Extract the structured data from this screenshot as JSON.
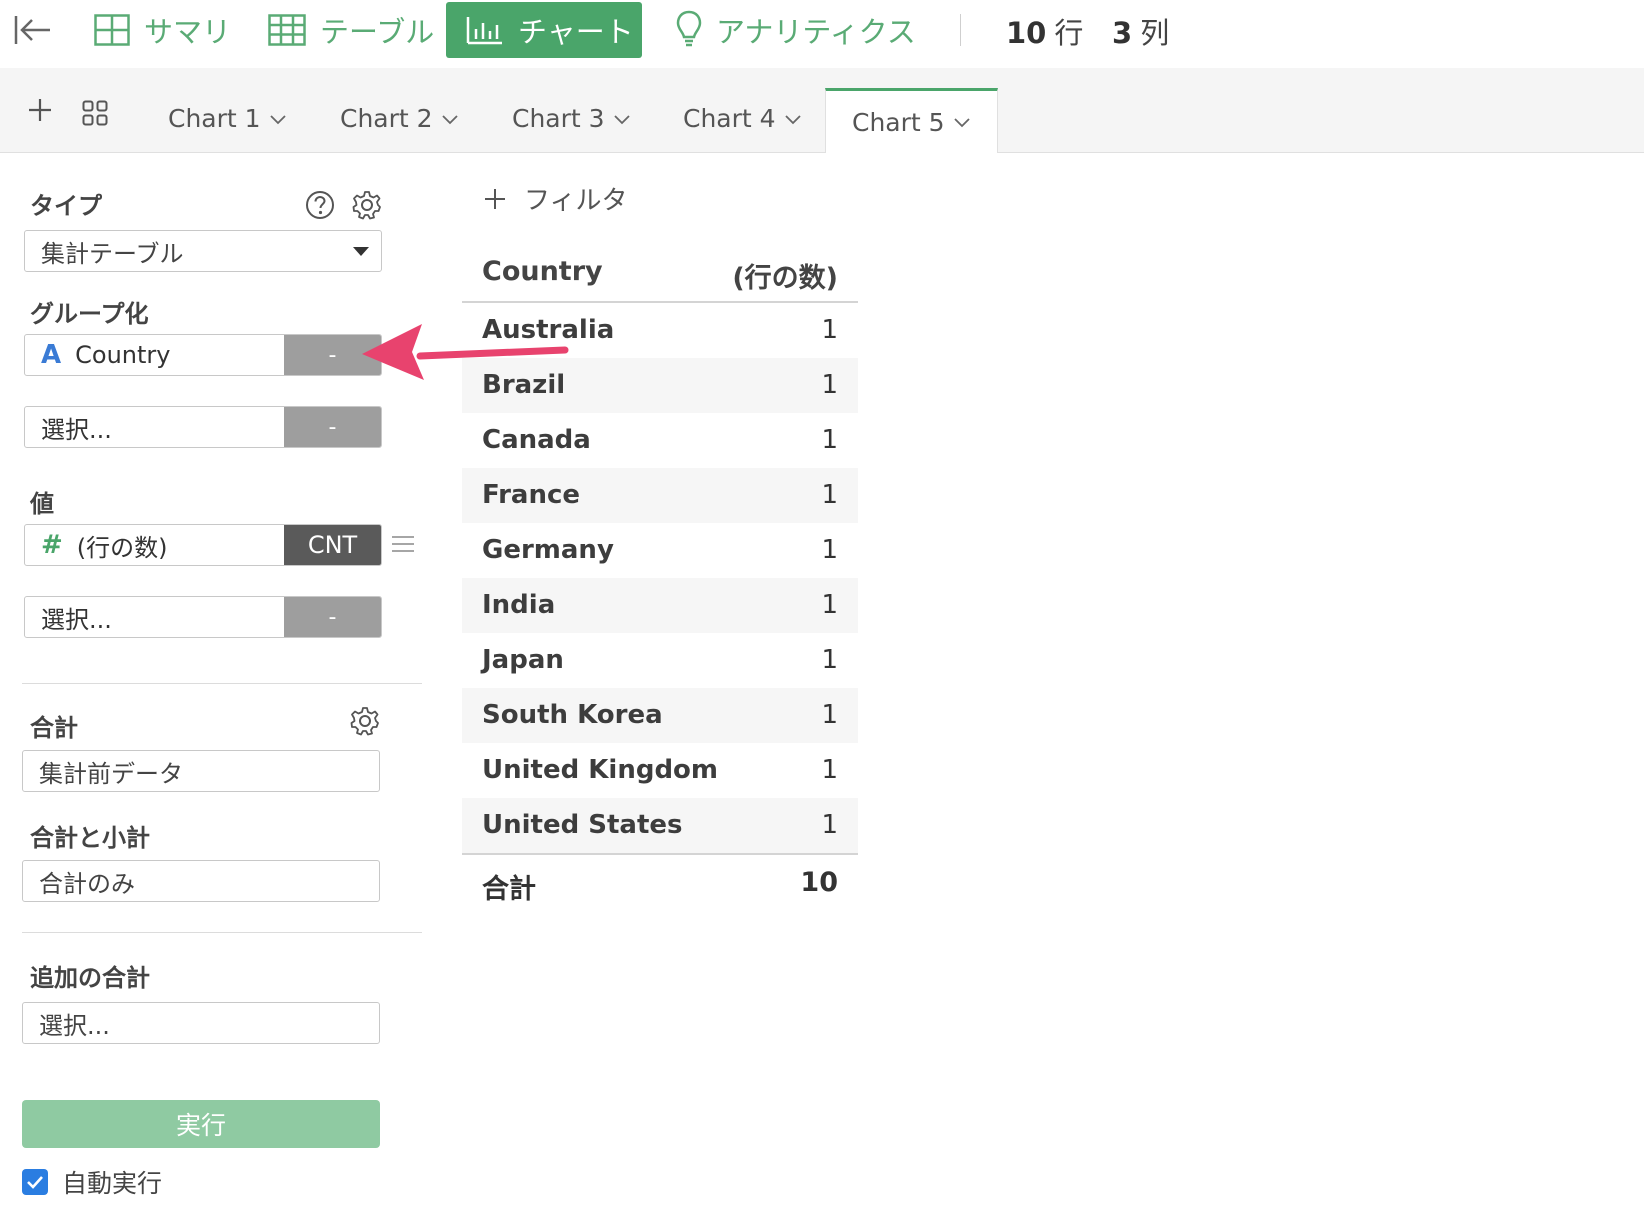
{
  "toolbar": {
    "summary": "サマリ",
    "table": "テーブル",
    "chart": "チャート",
    "analytics": "アナリティクス",
    "rows_value": "10",
    "rows_unit": "行",
    "cols_value": "3",
    "cols_unit": "列"
  },
  "tabs": [
    {
      "label": "Chart 1"
    },
    {
      "label": "Chart 2"
    },
    {
      "label": "Chart 3"
    },
    {
      "label": "Chart 4"
    },
    {
      "label": "Chart 5"
    }
  ],
  "active_tab": "Chart 5",
  "panel": {
    "type_label": "タイプ",
    "type_value": "集計テーブル",
    "group_label": "グループ化",
    "group_field": "Country",
    "group_field_icon": "A",
    "group_field_btn": "-",
    "group_select": "選択...",
    "group_select_btn": "-",
    "value_label": "値",
    "value_field": "(行の数)",
    "value_field_icon": "#",
    "value_field_btn": "CNT",
    "value_select": "選択...",
    "value_select_btn": "-",
    "total_label": "合計",
    "total_value": "集計前データ",
    "subtotal_label": "合計と小計",
    "subtotal_value": "合計のみ",
    "extra_total_label": "追加の合計",
    "extra_total_value": "選択...",
    "run_label": "実行",
    "auto_run_label": "自動実行",
    "auto_run_checked": true
  },
  "filter_label": "フィルタ",
  "table": {
    "headers": [
      "Country",
      "(行の数)"
    ],
    "rows": [
      {
        "country": "Australia",
        "count": "1"
      },
      {
        "country": "Brazil",
        "count": "1"
      },
      {
        "country": "Canada",
        "count": "1"
      },
      {
        "country": "France",
        "count": "1"
      },
      {
        "country": "Germany",
        "count": "1"
      },
      {
        "country": "India",
        "count": "1"
      },
      {
        "country": "Japan",
        "count": "1"
      },
      {
        "country": "South Korea",
        "count": "1"
      },
      {
        "country": "United Kingdom",
        "count": "1"
      },
      {
        "country": "United States",
        "count": "1"
      }
    ],
    "total_label": "合計",
    "total_value": "10"
  },
  "colors": {
    "accent": "#4aa56a",
    "accent_light": "#8fcaa2",
    "annotation_arrow": "#e8436e",
    "checkbox": "#2a7de1",
    "text_field_icon": "#3a7bd5",
    "number_field_icon": "#4aa56a"
  },
  "icons": {
    "back": "collapse-left-icon",
    "summary": "summary-grid-icon",
    "table": "table-icon",
    "chart": "bar-chart-icon",
    "analytics": "lightbulb-icon",
    "add_chart": "plus-icon",
    "chart_list": "grid-icon",
    "tab_menu": "chevron-down-icon",
    "help": "help-icon",
    "settings": "gear-icon",
    "reorder": "menu-icon"
  }
}
